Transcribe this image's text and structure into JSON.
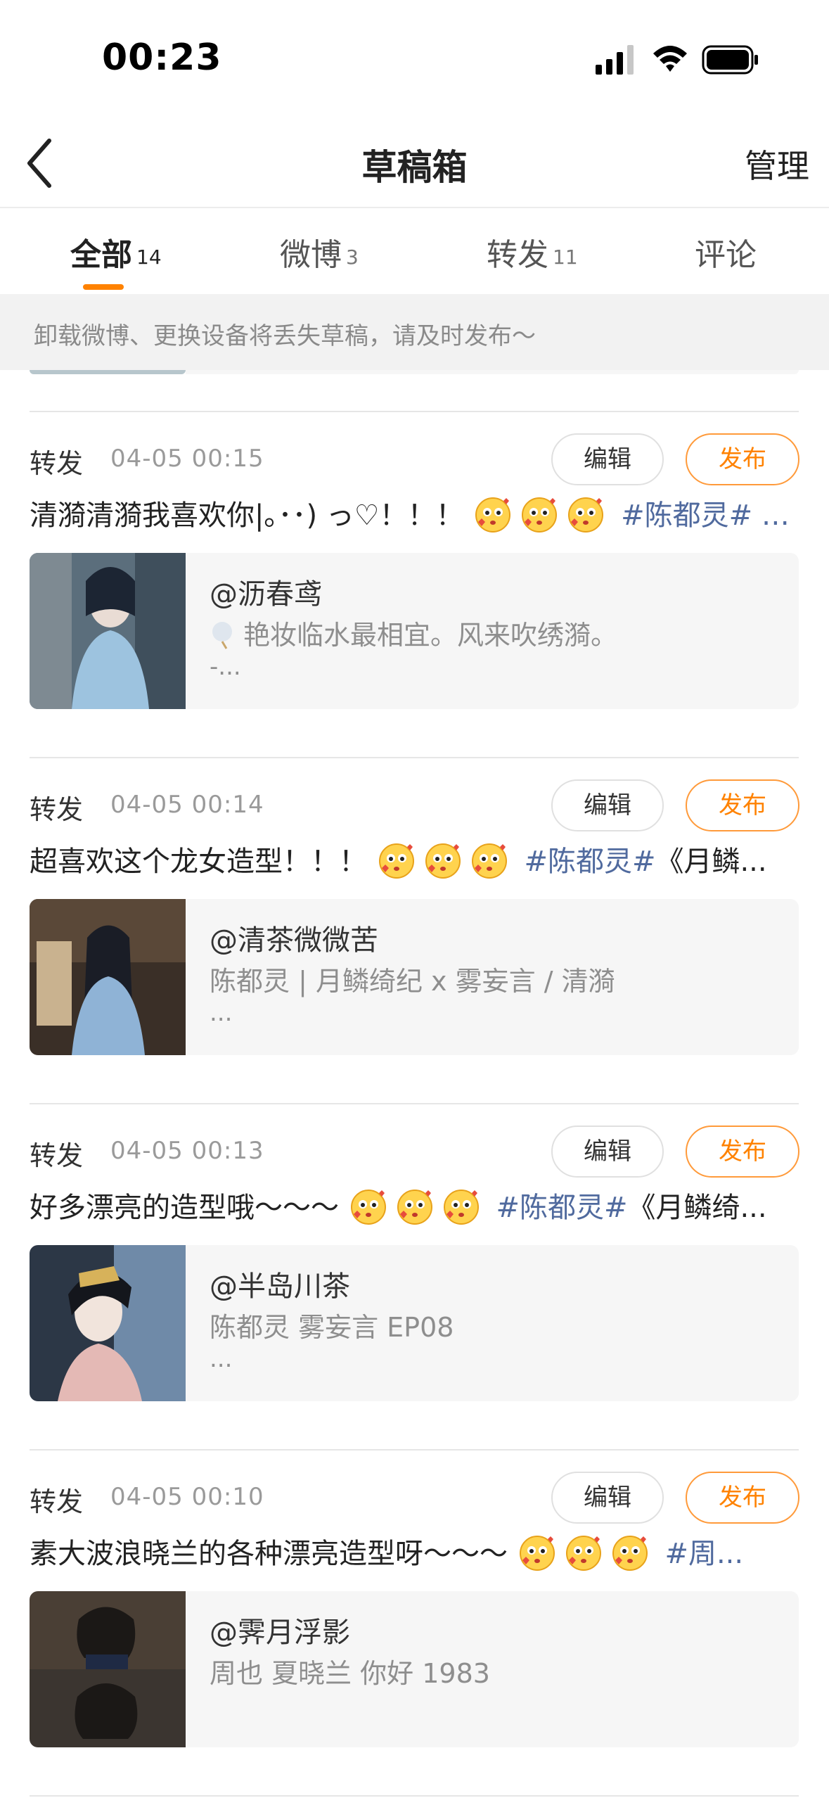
{
  "status_bar": {
    "time": "00:23"
  },
  "nav": {
    "title": "草稿箱",
    "manage_label": "管理"
  },
  "tabs": [
    {
      "label": "全部",
      "count": "14",
      "active": true
    },
    {
      "label": "微博",
      "count": "3",
      "active": false
    },
    {
      "label": "转发",
      "count": "11",
      "active": false
    },
    {
      "label": "评论",
      "count": "",
      "active": false
    }
  ],
  "notice": "卸载微博、更换设备将丢失草稿，请及时发布～",
  "buttons": {
    "edit": "编辑",
    "publish": "发布"
  },
  "drafts": [
    {
      "type": "转发",
      "date": "04-05 00:15",
      "text": "清漪清漪我喜欢你|｡･･) っ♡！！！",
      "emoji": "hearts-face-emoji",
      "tag": "#陈都灵# …",
      "tail": "",
      "card": {
        "user": "@沥春鸢",
        "text": "艳妆临水最相宜。风来吹绣漪。",
        "more": "-...",
        "thumb": "portrait-blue-robe"
      }
    },
    {
      "type": "转发",
      "date": "04-05 00:14",
      "text": "超喜欢这个龙女造型！！！",
      "emoji": "hearts-face-emoji",
      "tag": "#陈都灵#",
      "tail": "《月鳞...",
      "card": {
        "user": "@清茶微微苦",
        "text": "陈都灵 | 月鳞绮纪 x 雾妄言 / 清漪",
        "more": "...",
        "thumb": "portrait-dragon-girl"
      }
    },
    {
      "type": "转发",
      "date": "04-05 00:13",
      "text": "好多漂亮的造型哦～～～",
      "emoji": "hearts-face-emoji",
      "tag": "#陈都灵#",
      "tail": "《月鳞绮...",
      "card": {
        "user": "@半岛川茶",
        "text": "陈都灵 雾妄言 EP08",
        "more": "...",
        "thumb": "portrait-headdress"
      }
    },
    {
      "type": "转发",
      "date": "04-05 00:10",
      "text": "素大波浪晓兰的各种漂亮造型呀～～～",
      "emoji": "hearts-face-emoji",
      "tag": "#周...",
      "tail": "",
      "card": {
        "user": "@霁月浮影",
        "text": "周也 夏晓兰 你好 1983",
        "more": "",
        "thumb": "portrait-wavy-hair"
      }
    }
  ]
}
